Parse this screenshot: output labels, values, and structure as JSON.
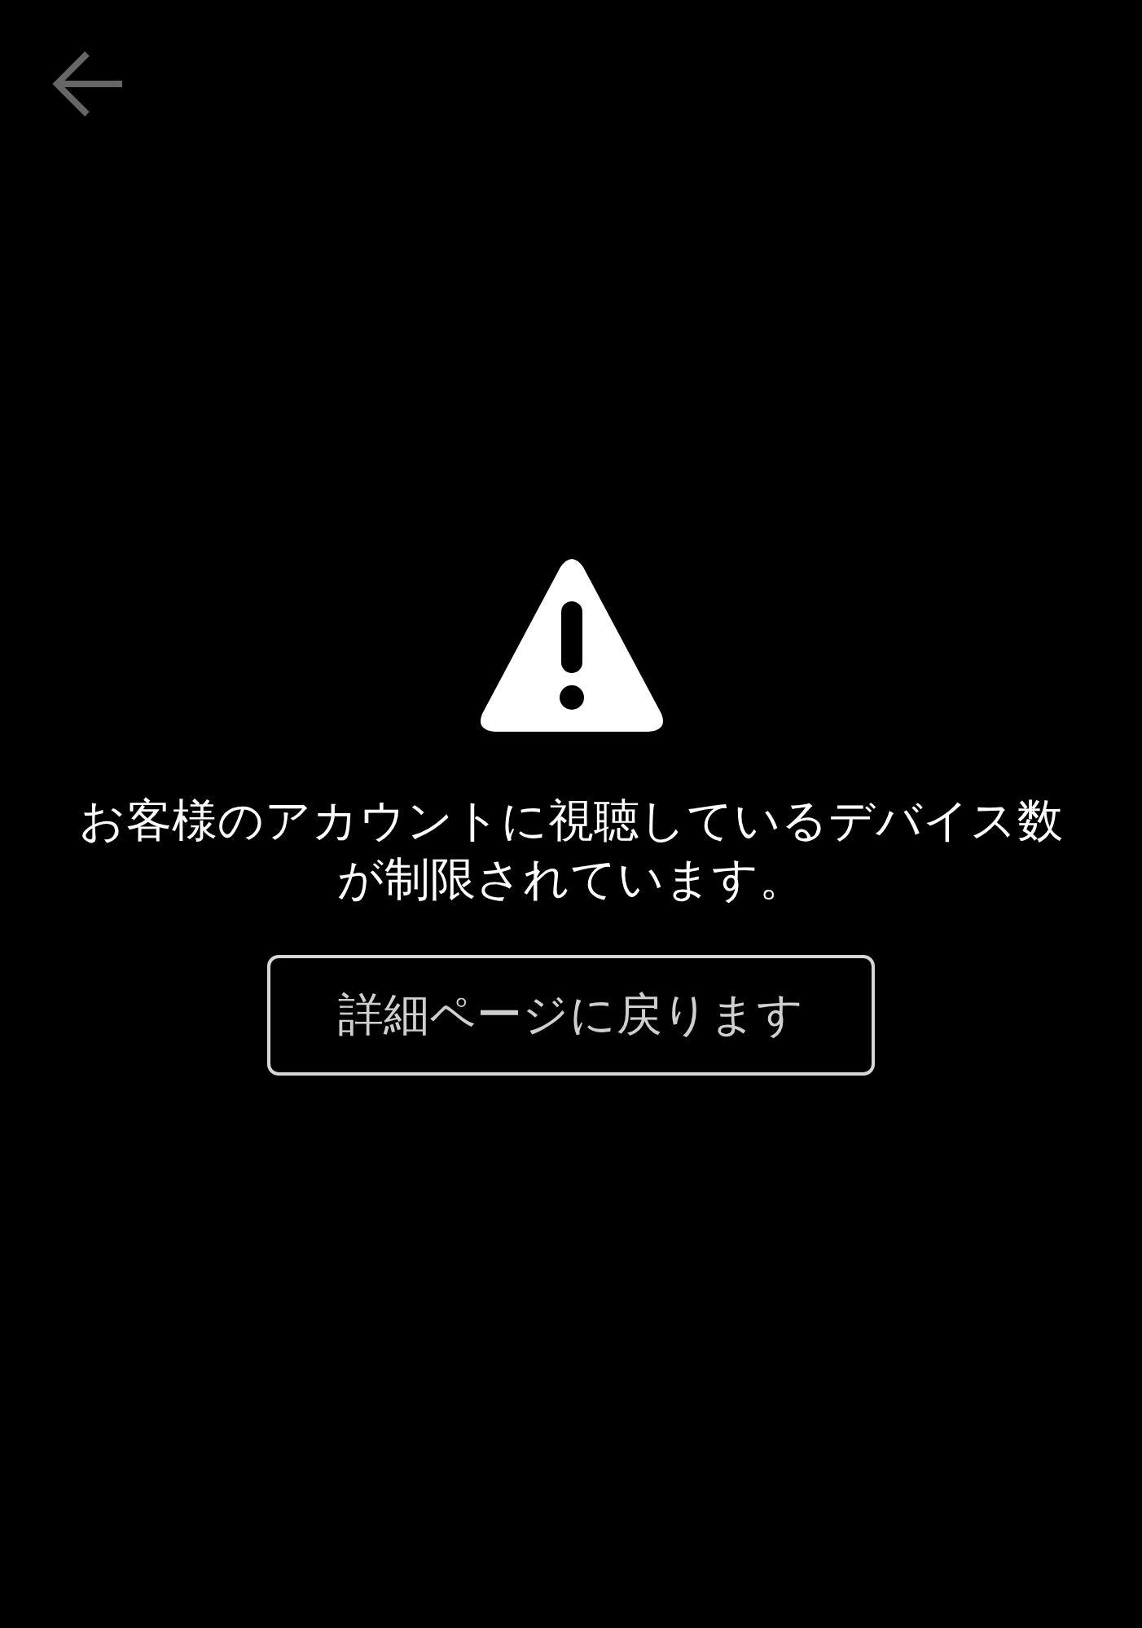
{
  "alert": {
    "message": "お客様のアカウントに視聴しているデバイス数が制限されています。",
    "button": "詳細ページに戻ります"
  }
}
